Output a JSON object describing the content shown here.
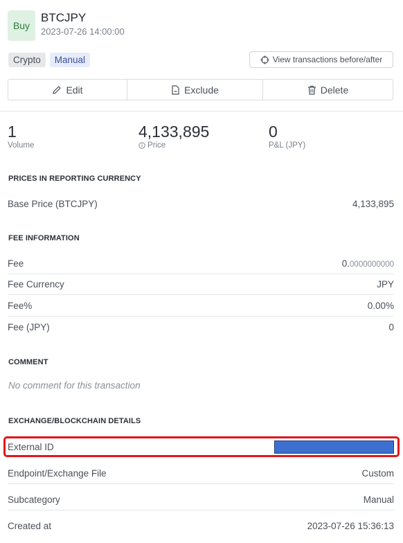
{
  "header": {
    "type_badge": "Buy",
    "pair": "BTCJPY",
    "datetime": "2023-07-26 14:00:00"
  },
  "tags": [
    "Crypto",
    "Manual"
  ],
  "view_button": "View transactions before/after",
  "actions": {
    "edit": "Edit",
    "exclude": "Exclude",
    "delete": "Delete"
  },
  "stats": {
    "volume": {
      "value": "1",
      "label": "Volume"
    },
    "price": {
      "value": "4,133,895",
      "label": "Price"
    },
    "pl": {
      "value": "0",
      "label": "P&L (JPY)"
    }
  },
  "prices_section": {
    "title": "PRICES IN REPORTING CURRENCY",
    "rows": [
      {
        "label": "Base Price (BTCJPY)",
        "value": "4,133,895"
      }
    ]
  },
  "fee_section": {
    "title": "FEE INFORMATION",
    "fee": {
      "label": "Fee",
      "value_lead": "0.",
      "value_rest": "0000000000"
    },
    "rows": [
      {
        "label": "Fee Currency",
        "value": "JPY"
      },
      {
        "label": "Fee%",
        "value": "0.00%"
      },
      {
        "label": "Fee (JPY)",
        "value": "0"
      }
    ]
  },
  "comment_section": {
    "title": "COMMENT",
    "text": "No comment for this transaction"
  },
  "exchange_section": {
    "title": "EXCHANGE/BLOCKCHAIN DETAILS",
    "external_id_label": "External ID",
    "rows": [
      {
        "label": "Endpoint/Exchange File",
        "value": "Custom"
      },
      {
        "label": "Subcategory",
        "value": "Manual"
      },
      {
        "label": "Created at",
        "value": "2023-07-26 15:36:13"
      }
    ]
  },
  "colors": {
    "buy_badge_bg": "#dff1e2",
    "buy_badge_text": "#2e7d3d",
    "manual_tag_text": "#3b4f9e",
    "highlight_border": "#e0161b",
    "redaction": "#3d6fcf"
  }
}
